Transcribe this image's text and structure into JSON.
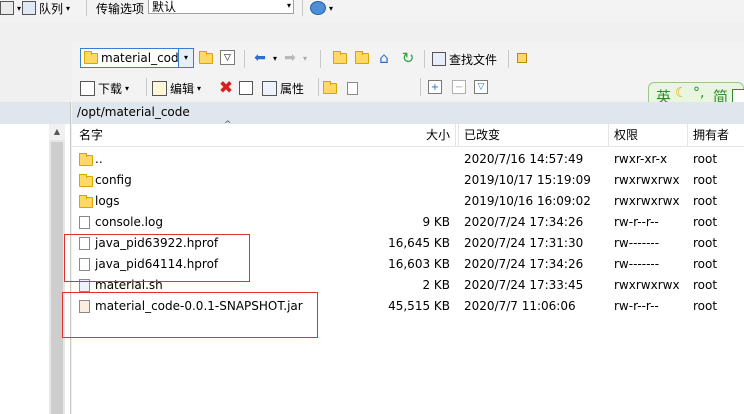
{
  "top_toolbar": {
    "queue_label": "队列",
    "transfer_options_label": "传输选项",
    "transfer_mode_value": "默认"
  },
  "remote_toolbar": {
    "path_combo_value": "material_code",
    "find_file_label": "查找文件",
    "download_label": "下载",
    "edit_label": "编辑",
    "properties_label": "属性"
  },
  "ime": {
    "lang_char": "英",
    "mode_char": "简"
  },
  "path_bar": {
    "path": "/opt/material_code"
  },
  "columns": {
    "name": "名字",
    "size": "大小",
    "modified": "已改变",
    "permissions": "权限",
    "owner": "拥有者"
  },
  "files": [
    {
      "name": "..",
      "size": "",
      "modified": "2020/7/16 14:57:49",
      "permissions": "rwxr-xr-x",
      "owner": "root",
      "icon": "parent-dir-icon"
    },
    {
      "name": "config",
      "size": "",
      "modified": "2019/10/17 15:19:09",
      "permissions": "rwxrwxrwx",
      "owner": "root",
      "icon": "folder-icon"
    },
    {
      "name": "logs",
      "size": "",
      "modified": "2019/10/16 16:09:02",
      "permissions": "rwxrwxrwx",
      "owner": "root",
      "icon": "folder-icon"
    },
    {
      "name": "console.log",
      "size": "9 KB",
      "modified": "2020/7/24 17:34:26",
      "permissions": "rw-r--r--",
      "owner": "root",
      "icon": "text-file-icon"
    },
    {
      "name": "java_pid63922.hprof",
      "size": "16,645 KB",
      "modified": "2020/7/24 17:31:30",
      "permissions": "rw-------",
      "owner": "root",
      "icon": "file-icon"
    },
    {
      "name": "java_pid64114.hprof",
      "size": "16,603 KB",
      "modified": "2020/7/24 17:34:26",
      "permissions": "rw-------",
      "owner": "root",
      "icon": "file-icon"
    },
    {
      "name": "material.sh",
      "size": "2 KB",
      "modified": "2020/7/24 17:33:45",
      "permissions": "rwxrwxrwx",
      "owner": "root",
      "icon": "script-file-icon"
    },
    {
      "name": "material_code-0.0.1-SNAPSHOT.jar",
      "size": "45,515 KB",
      "modified": "2020/7/7 11:06:06",
      "permissions": "rw-r--r--",
      "owner": "root",
      "icon": "jar-file-icon"
    }
  ]
}
